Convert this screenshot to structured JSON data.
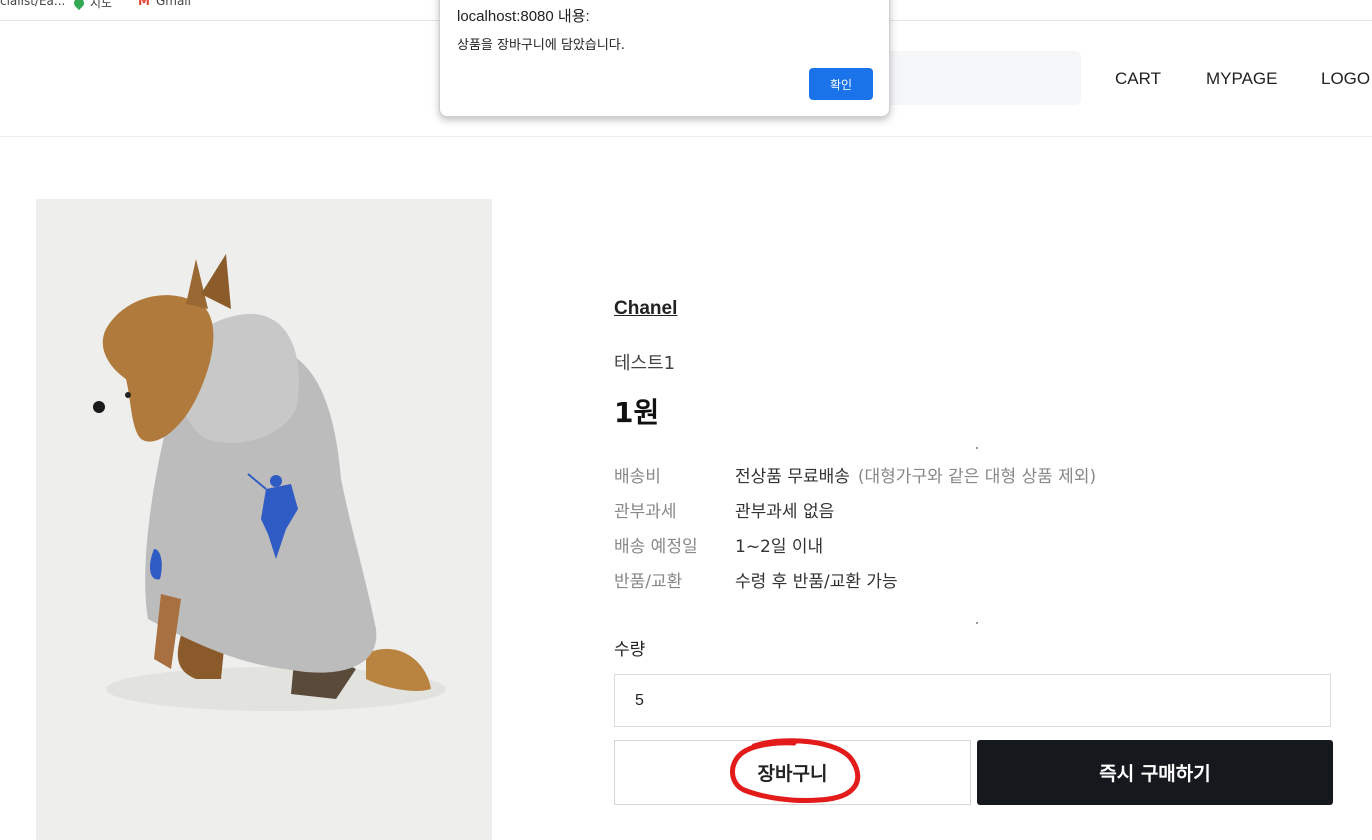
{
  "bookmarks": [
    {
      "label": "cialist/Ea..."
    },
    {
      "label": "지도"
    },
    {
      "label": "Gmail"
    }
  ],
  "header": {
    "nav": [
      "CART",
      "MYPAGE",
      "LOGO"
    ]
  },
  "dialog": {
    "title": "localhost:8080 내용:",
    "message": "상품을 장바구니에 담았습니다.",
    "ok_label": "확인"
  },
  "product": {
    "brand": "Chanel",
    "name": "테스트1",
    "price": "1원",
    "info": [
      {
        "label": "배송비",
        "value": "전상품 무료배송",
        "note": "(대형가구와 같은 대형 상품 제외)"
      },
      {
        "label": "관부과세",
        "value": "관부과세 없음"
      },
      {
        "label": "배송 예정일",
        "value": "1~2일 이내"
      },
      {
        "label": "반품/교환",
        "value": "수령 후 반품/교환 가능"
      }
    ],
    "quantity_label": "수량",
    "quantity_value": "5",
    "cart_button": "장바구니",
    "buy_button": "즉시 구매하기"
  },
  "colors": {
    "buy_button_bg": "#15181c",
    "dialog_ok_bg": "#1a73e8",
    "annotation_red": "#e31b1b"
  }
}
